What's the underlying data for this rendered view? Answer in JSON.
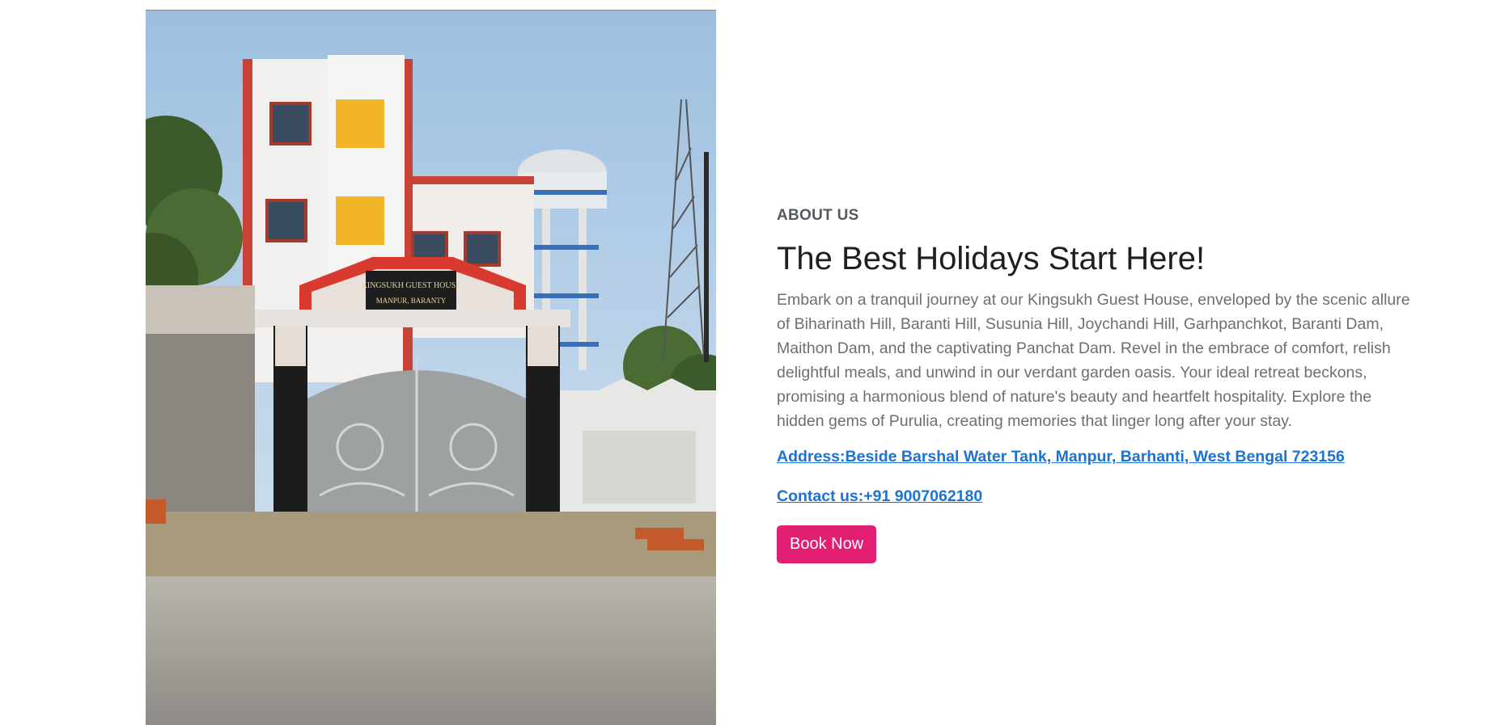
{
  "photo": {
    "alt": "Kingsukh Guest House building",
    "sign_line_1": "KINGSUKH GUEST HOUSE",
    "sign_line_2": "MANPUR, BARANTY"
  },
  "about": {
    "eyebrow": "ABOUT US",
    "heading": "The Best Holidays Start Here!",
    "description": "Embark on a tranquil journey at our Kingsukh Guest House, enveloped by the scenic allure of Biharinath Hill, Baranti Hill, Susunia Hill, Joychandi Hill, Garhpanchkot, Baranti Dam, Maithon Dam, and the captivating Panchat Dam. Revel in the embrace of comfort, relish delightful meals, and unwind in our verdant garden oasis. Your ideal retreat beckons, promising a harmonious blend of nature's beauty and heartfelt hospitality. Explore the hidden gems of Purulia, creating memories that linger long after your stay.",
    "address": "Address:Beside Barshal Water Tank, Manpur, Barhanti, West Bengal 723156",
    "contact": "Contact us:+91 9007062180",
    "book_label": "Book Now"
  },
  "colors": {
    "accent": "#e31f74",
    "link": "#1c73d4",
    "heading": "#1d1f22",
    "body": "#6b6f74"
  }
}
